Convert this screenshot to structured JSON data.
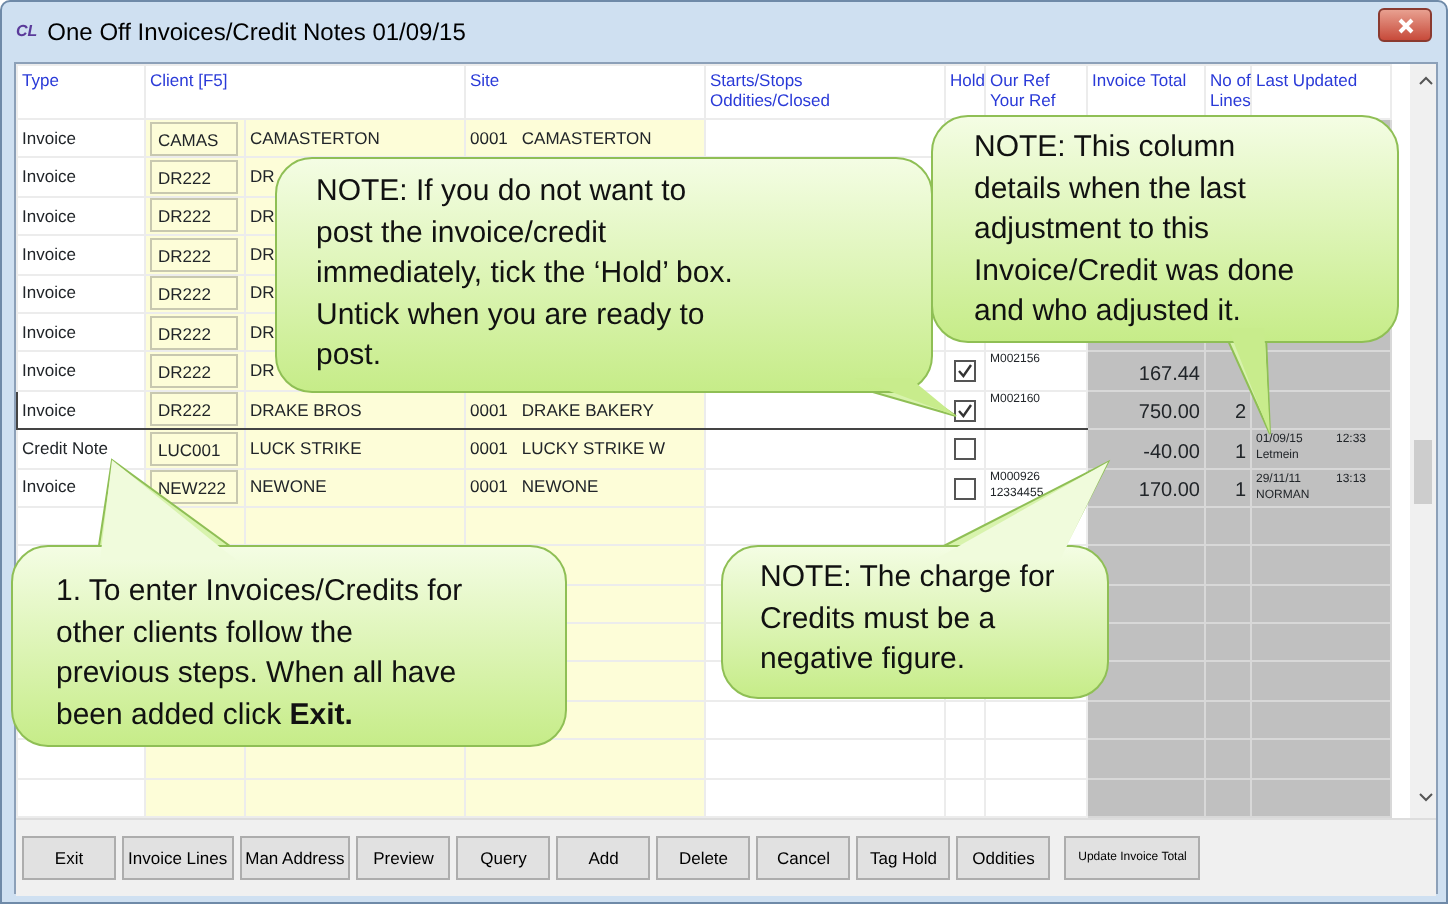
{
  "window": {
    "badge": "CL",
    "title": "One Off Invoices/Credit Notes 01/09/15"
  },
  "table": {
    "columns": [
      {
        "kind": "type",
        "label": "Type"
      },
      {
        "kind": "client",
        "label": "Client [F5]"
      },
      {
        "kind": "site",
        "label": "Site"
      },
      {
        "kind": "starts",
        "label": "Starts/Stops",
        "label_2": "Oddities/Closed"
      },
      {
        "kind": "hold",
        "label": "Hold"
      },
      {
        "kind": "ref",
        "label": "Our Ref",
        "label_2": "Your Ref"
      },
      {
        "kind": "total",
        "label": "Invoice Total"
      },
      {
        "kind": "lines",
        "label": "No of",
        "label_2": "Lines"
      },
      {
        "kind": "updated",
        "label": "Last Updated"
      }
    ],
    "rows": [
      {
        "type": "Invoice",
        "client_code": "CAMAS",
        "client_name": "CAMASTERTON",
        "site_code": "0001",
        "site_name": "CAMASTERTON",
        "selected": false
      },
      {
        "type": "Invoice",
        "client_code": "DR222",
        "client_name": "DR",
        "selected": false
      },
      {
        "type": "Invoice",
        "client_code": "DR222",
        "client_name": "DR",
        "selected": false
      },
      {
        "type": "Invoice",
        "client_code": "DR222",
        "client_name": "DR",
        "selected": false
      },
      {
        "type": "Invoice",
        "client_code": "DR222",
        "client_name": "DR",
        "selected": false
      },
      {
        "type": "Invoice",
        "client_code": "DR222",
        "client_name": "DR",
        "selected": false
      },
      {
        "type": "Invoice",
        "client_code": "DR222",
        "client_name": "DR",
        "hold": true,
        "our_ref": "M002156",
        "total": "167.44",
        "selected": false
      },
      {
        "type": "Invoice",
        "client_code": "DR222",
        "client_name": "DRAKE BROS",
        "site_code": "0001",
        "site_name": "DRAKE BAKERY",
        "hold": true,
        "our_ref": "M002160",
        "total": "750.00",
        "lines": "2",
        "selected": true
      },
      {
        "type": "Credit Note",
        "client_code": "LUC001",
        "client_name": "LUCK STRIKE",
        "site_code": "0001",
        "site_name": "LUCKY STRIKE W",
        "hold": false,
        "total": "-40.00",
        "lines": "1",
        "updated_date": "01/09/15",
        "updated_time": "12:33",
        "updated_by": "Letmein",
        "selected": false
      },
      {
        "type": "Invoice",
        "client_code": "NEW222",
        "client_name": "NEWONE",
        "site_code": "0001",
        "site_name": "NEWONE",
        "hold": false,
        "our_ref": "M000926",
        "your_ref": "12334455",
        "total": "170.00",
        "lines": "1",
        "updated_date": "29/11/11",
        "updated_time": "13:13",
        "updated_by": "NORMAN",
        "selected": false
      }
    ]
  },
  "callouts": [
    {
      "kind": "top-middle",
      "text": "NOTE: If you do not want to post the invoice/credit immediately, tick the ‘Hold’ box. Untick when you are ready to post."
    },
    {
      "kind": "top-right",
      "text": "NOTE: This column details when the last adjustment to this Invoice/Credit was done and who adjusted it."
    },
    {
      "kind": "bottom-left",
      "text": "1. To enter Invoices/Credits for other clients follow the previous steps. When all have been added click **Exit.**"
    },
    {
      "kind": "bottom-middle",
      "text": "NOTE: The charge for Credits must be a negative figure."
    }
  ],
  "buttons": [
    {
      "label": "Exit",
      "kind": "normal"
    },
    {
      "label": "Invoice Lines",
      "kind": "normal"
    },
    {
      "label": "Man Address",
      "kind": "normal"
    },
    {
      "label": "Preview",
      "kind": "normal"
    },
    {
      "label": "Query",
      "kind": "normal"
    },
    {
      "label": "Add",
      "kind": "normal"
    },
    {
      "label": "Delete",
      "kind": "normal"
    },
    {
      "label": "Cancel",
      "kind": "normal"
    },
    {
      "label": "Tag Hold",
      "kind": "normal"
    },
    {
      "label": "Oddities",
      "kind": "normal"
    },
    {
      "label": "Update Invoice Total",
      "kind": "small"
    }
  ]
}
